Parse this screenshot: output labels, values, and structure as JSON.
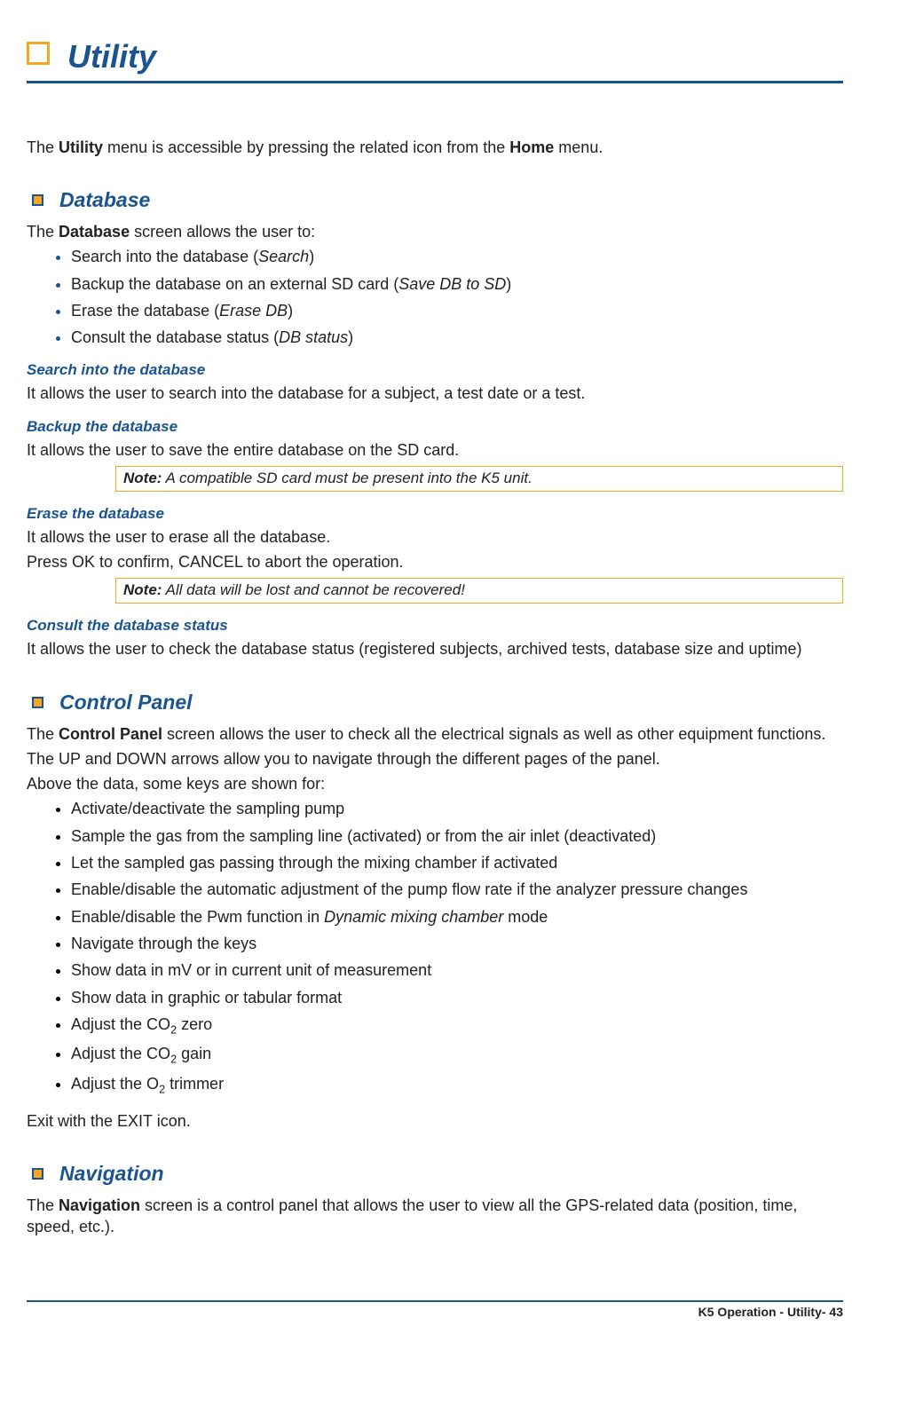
{
  "page_title": "Utility",
  "intro_prefix": "The ",
  "intro_bold1": "Utility",
  "intro_mid": " menu is accessible by pressing the related icon from the ",
  "intro_bold2": "Home",
  "intro_suffix": " menu.",
  "db_heading": "Database",
  "db_intro_pre": "The ",
  "db_intro_bold": "Database",
  "db_intro_post": " screen allows the user to:",
  "db_list": {
    "i0_a": "Search into the database (",
    "i0_b": "Search",
    "i0_c": ")",
    "i1_a": "Backup the database on an external SD card (",
    "i1_b": "Save DB to SD",
    "i1_c": ")",
    "i2_a": "Erase the database (",
    "i2_b": "Erase DB",
    "i2_c": ")",
    "i3_a": "Consult the database status (",
    "i3_b": "DB status",
    "i3_c": ")"
  },
  "db_search_title": "Search into the database",
  "db_search_text": "It allows the user to search into the database for a subject, a test date or a test.",
  "db_backup_title": "Backup the database",
  "db_backup_text": "It allows the user to save the entire database on the SD card.",
  "db_backup_note_label": "Note:",
  "db_backup_note": " A compatible SD card must be present into the K5 unit.",
  "db_erase_title": "Erase the database",
  "db_erase_text1": "It allows the user to erase all the database.",
  "db_erase_text2": "Press OK to confirm, CANCEL to abort the operation.",
  "db_erase_note_label": "Note:",
  "db_erase_note": " All data will be lost and cannot be recovered!",
  "db_status_title": "Consult the database status",
  "db_status_text": "It allows the user to check the database status (registered subjects, archived tests, database size and uptime)",
  "cp_heading": "Control Panel",
  "cp_intro_pre": "The ",
  "cp_intro_bold": "Control Panel",
  "cp_intro_post": " screen allows the user to check all the electrical signals as well as other equipment functions.",
  "cp_line2": "The UP and DOWN arrows allow you to navigate through the different pages of the panel.",
  "cp_line3": "Above the data, some keys are shown for:",
  "cp_list": {
    "i0": "Activate/deactivate the sampling pump",
    "i1": "Sample the gas from the sampling line (activated) or from the air inlet (deactivated)",
    "i2": "Let the sampled gas passing through the mixing chamber if activated",
    "i3": "Enable/disable the automatic adjustment of the pump flow rate if the analyzer pressure changes",
    "i4_a": "Enable/disable the Pwm function in ",
    "i4_b": "Dynamic mixing chamber",
    "i4_c": " mode",
    "i5": "Navigate through the keys",
    "i6": "Show data in mV or in current unit of measurement",
    "i7": "Show data in graphic or tabular format",
    "i8_a": "Adjust the CO",
    "i8_b": "2",
    "i8_c": " zero",
    "i9_a": "Adjust the CO",
    "i9_b": "2",
    "i9_c": " gain",
    "i10_a": "Adjust the O",
    "i10_b": "2",
    "i10_c": " trimmer"
  },
  "cp_exit": "Exit with the EXIT icon.",
  "nav_heading": "Navigation",
  "nav_intro_pre": "The ",
  "nav_intro_bold": "Navigation",
  "nav_intro_post": " screen is a control panel that allows the user to view all the GPS-related data (position, time, speed, etc.).",
  "footer": "K5 Operation - Utility- 43"
}
